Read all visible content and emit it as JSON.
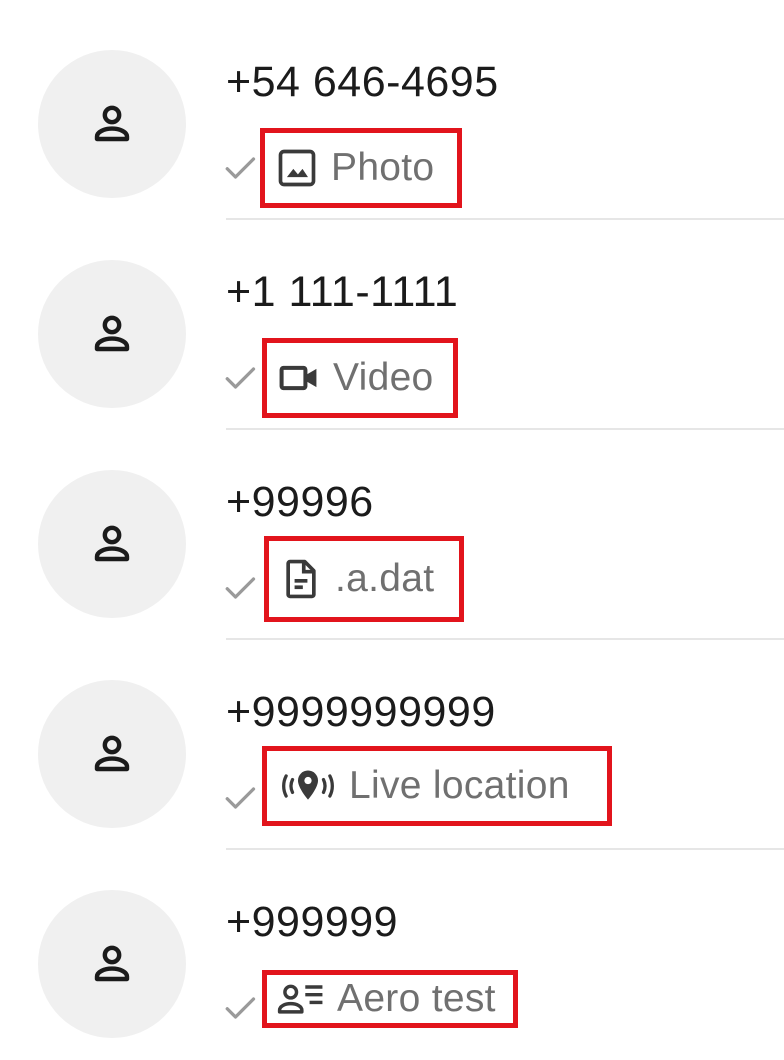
{
  "colors": {
    "name_text": "#1b1b1b",
    "preview_text": "#707070",
    "check": "#9a9a9a",
    "avatar_bg": "#f0f0f0",
    "highlight_border": "#e2141c",
    "divider": "#e6e6e6"
  },
  "chats": [
    {
      "name": "+54 646-4695",
      "preview_icon": "photo-icon",
      "preview": "Photo",
      "status_icon": "check-icon"
    },
    {
      "name": "+1 111-1111",
      "preview_icon": "video-icon",
      "preview": "Video",
      "status_icon": "check-icon"
    },
    {
      "name": "+99996",
      "preview_icon": "document-icon",
      "preview": ".a.dat",
      "status_icon": "check-icon"
    },
    {
      "name": "+9999999999",
      "preview_icon": "live-location-icon",
      "preview": "Live location",
      "status_icon": "check-icon"
    },
    {
      "name": "+999999",
      "preview_icon": "contact-icon",
      "preview": "Aero test",
      "status_icon": "check-icon"
    }
  ]
}
